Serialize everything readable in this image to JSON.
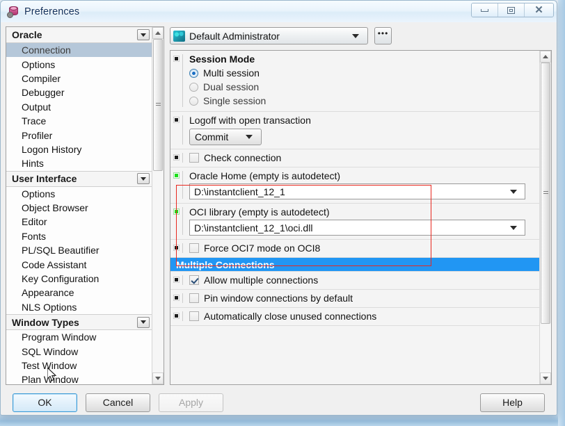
{
  "window": {
    "title": "Preferences",
    "app_icon": "database-gear-icon",
    "controls": {
      "minimize": "minimize-icon",
      "maximize": "maximize-icon",
      "close": "close-icon"
    }
  },
  "tree": {
    "groups": [
      {
        "label": "Oracle",
        "items": [
          {
            "label": "Connection",
            "selected": true
          },
          {
            "label": "Options",
            "selected": false
          },
          {
            "label": "Compiler",
            "selected": false
          },
          {
            "label": "Debugger",
            "selected": false
          },
          {
            "label": "Output",
            "selected": false
          },
          {
            "label": "Trace",
            "selected": false
          },
          {
            "label": "Profiler",
            "selected": false
          },
          {
            "label": "Logon History",
            "selected": false
          },
          {
            "label": "Hints",
            "selected": false
          }
        ]
      },
      {
        "label": "User Interface",
        "items": [
          {
            "label": "Options",
            "selected": false
          },
          {
            "label": "Object Browser",
            "selected": false
          },
          {
            "label": "Editor",
            "selected": false
          },
          {
            "label": "Fonts",
            "selected": false
          },
          {
            "label": "PL/SQL Beautifier",
            "selected": false
          },
          {
            "label": "Code Assistant",
            "selected": false
          },
          {
            "label": "Key Configuration",
            "selected": false
          },
          {
            "label": "Appearance",
            "selected": false
          },
          {
            "label": "NLS Options",
            "selected": false
          }
        ]
      },
      {
        "label": "Window Types",
        "items": [
          {
            "label": "Program Window",
            "selected": false
          },
          {
            "label": "SQL Window",
            "selected": false
          },
          {
            "label": "Test Window",
            "selected": false
          },
          {
            "label": "Plan Window",
            "selected": false
          }
        ]
      }
    ]
  },
  "profile": {
    "value": "Default Administrator",
    "icon": "user-group-icon",
    "dropdown_icon": "chevron-down-icon",
    "ellipsis_label": "•••"
  },
  "settings": {
    "session_mode": {
      "title": "Session Mode",
      "options": [
        {
          "label": "Multi session",
          "selected": true
        },
        {
          "label": "Dual session",
          "selected": false
        },
        {
          "label": "Single session",
          "selected": false
        }
      ]
    },
    "logoff": {
      "label": "Logoff with open transaction",
      "value": "Commit"
    },
    "check_connection": {
      "label": "Check connection",
      "checked": false
    },
    "oracle_home": {
      "label": "Oracle Home (empty is autodetect)",
      "value": "D:\\instantclient_12_1"
    },
    "oci_library": {
      "label": "OCI library (empty is autodetect)",
      "value": "D:\\instantclient_12_1\\oci.dll"
    },
    "force_oci7": {
      "label": "Force OCI7 mode on OCI8",
      "checked": false
    },
    "multiple_connections_header": "Multiple Connections",
    "allow_multiple": {
      "label": "Allow multiple connections",
      "checked": true
    },
    "pin_window": {
      "label": "Pin window connections by default",
      "checked": false
    },
    "auto_close": {
      "label": "Automatically close unused connections",
      "checked": false
    }
  },
  "buttons": {
    "ok": "OK",
    "cancel": "Cancel",
    "apply": "Apply",
    "help": "Help"
  },
  "colors": {
    "selection": "#b5c7d9",
    "header_blue": "#2196f3",
    "highlight_red": "#e8281f",
    "marker_green": "#19e019",
    "title_text": "#12305b"
  }
}
